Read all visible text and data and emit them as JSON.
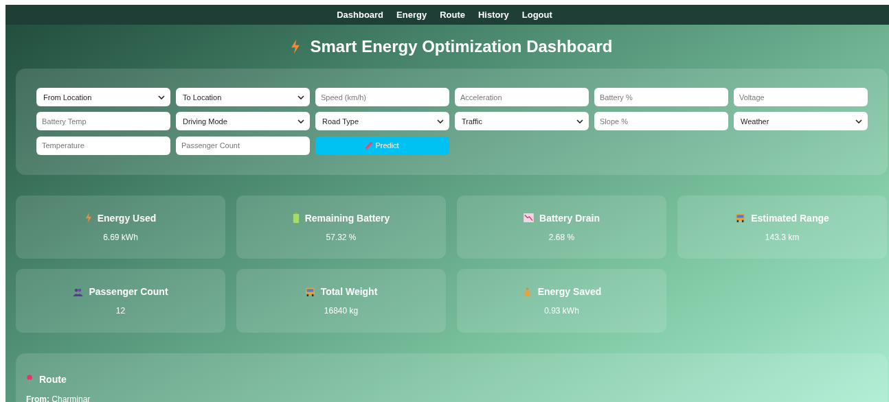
{
  "nav": [
    {
      "label": "Dashboard"
    },
    {
      "label": "Energy"
    },
    {
      "label": "Route"
    },
    {
      "label": "History"
    },
    {
      "label": "Logout"
    }
  ],
  "title": "Smart Energy Optimization Dashboard",
  "form": [
    {
      "kind": "select",
      "value": "From Location"
    },
    {
      "kind": "select",
      "value": "To Location"
    },
    {
      "kind": "input",
      "placeholder": "Speed (km/h)"
    },
    {
      "kind": "input",
      "placeholder": "Acceleration"
    },
    {
      "kind": "input",
      "placeholder": "Battery %"
    },
    {
      "kind": "input",
      "placeholder": "Voltage"
    },
    {
      "kind": "input",
      "placeholder": "Battery Temp"
    },
    {
      "kind": "select",
      "value": "Driving Mode"
    },
    {
      "kind": "select",
      "value": "Road Type"
    },
    {
      "kind": "select",
      "value": "Traffic"
    },
    {
      "kind": "input",
      "placeholder": "Slope %"
    },
    {
      "kind": "select",
      "value": "Weather"
    },
    {
      "kind": "input",
      "placeholder": "Temperature"
    },
    {
      "kind": "input",
      "placeholder": "Passenger Count"
    },
    {
      "kind": "button",
      "label": "Predict"
    }
  ],
  "cards": [
    {
      "title": "Energy Used",
      "value": "6.69 kWh"
    },
    {
      "title": "Remaining Battery",
      "value": "57.32 %"
    },
    {
      "title": "Battery Drain",
      "value": "2.68 %"
    },
    {
      "title": "Estimated Range",
      "value": "143.3 km"
    },
    {
      "title": "Passenger Count",
      "value": "12"
    },
    {
      "title": "Total Weight",
      "value": "16840 kg"
    },
    {
      "title": "Energy Saved",
      "value": "0.93 kWh"
    }
  ],
  "route": {
    "heading": "Route",
    "from_label": "From:",
    "from": "Charminar"
  }
}
